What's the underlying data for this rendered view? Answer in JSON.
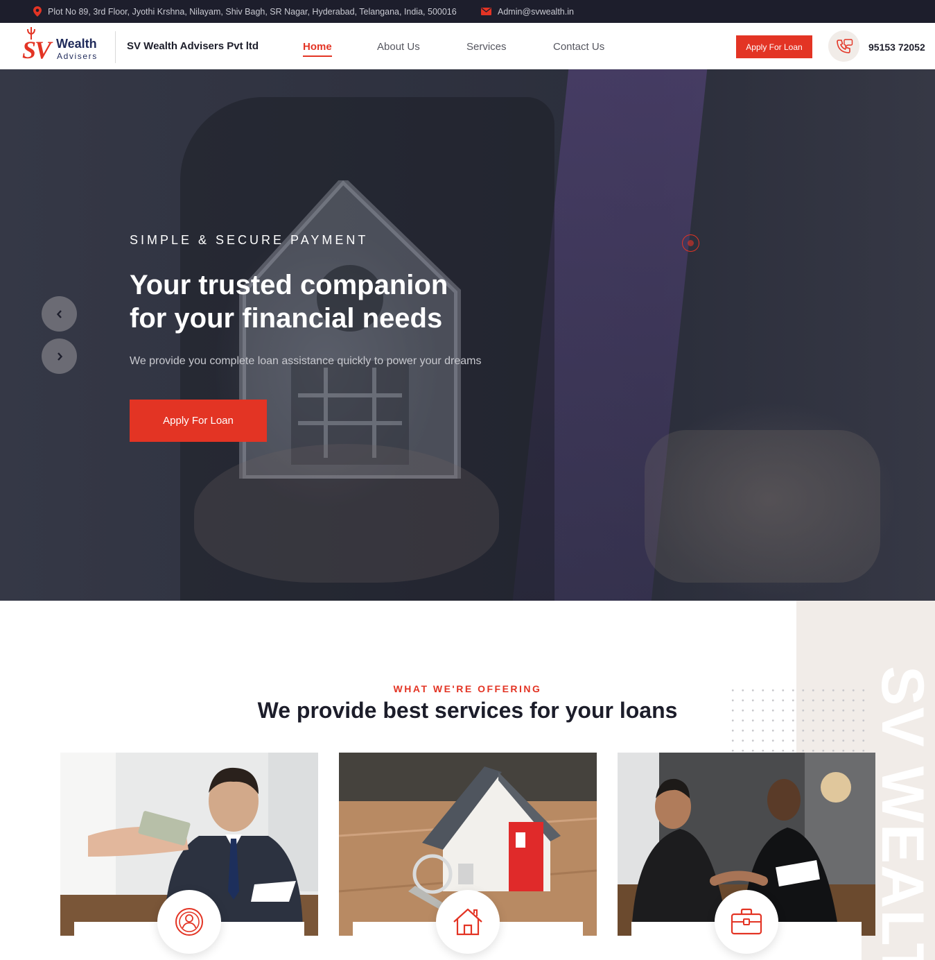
{
  "topbar": {
    "address": "Plot No 89, 3rd Floor, Jyothi Krshna, Nilayam, Shiv Bagh, SR Nagar, Hyderabad, Telangana, India, 500016",
    "email": "Admin@svwealth.in",
    "location_icon": "map-pin-icon",
    "email_icon": "envelope-icon"
  },
  "header": {
    "logo": {
      "mark": "SV",
      "word": "Wealth",
      "sub": "Advisers"
    },
    "company_name": "SV Wealth Advisers Pvt ltd",
    "nav": [
      {
        "label": "Home",
        "active": true
      },
      {
        "label": "About Us",
        "active": false
      },
      {
        "label": "Services",
        "active": false
      },
      {
        "label": "Contact Us",
        "active": false
      }
    ],
    "cta_label": "Apply For Loan",
    "phone": "95153 72052",
    "phone_icon": "phone-icon"
  },
  "hero": {
    "label": "SIMPLE & SECURE PAYMENT",
    "title_line1": "Your trusted companion",
    "title_line2": "for your financial needs",
    "subtitle": "We provide you complete loan assistance quickly to power your dreams",
    "cta_label": "Apply For Loan",
    "prev_icon": "chevron-left-icon",
    "next_icon": "chevron-right-icon"
  },
  "services": {
    "eyebrow": "WHAT WE'RE OFFERING",
    "title": "We provide best services for your loans",
    "side_text": "SV WEALT",
    "cards": [
      {
        "image": "handing-cash-photo",
        "icon": "user-circle-icon"
      },
      {
        "image": "model-house-keys-photo",
        "icon": "house-icon"
      },
      {
        "image": "business-meeting-photo",
        "icon": "briefcase-icon"
      }
    ]
  },
  "colors": {
    "accent": "#e33424",
    "dark": "#1d1e2c",
    "panel": "#f1ece8"
  }
}
